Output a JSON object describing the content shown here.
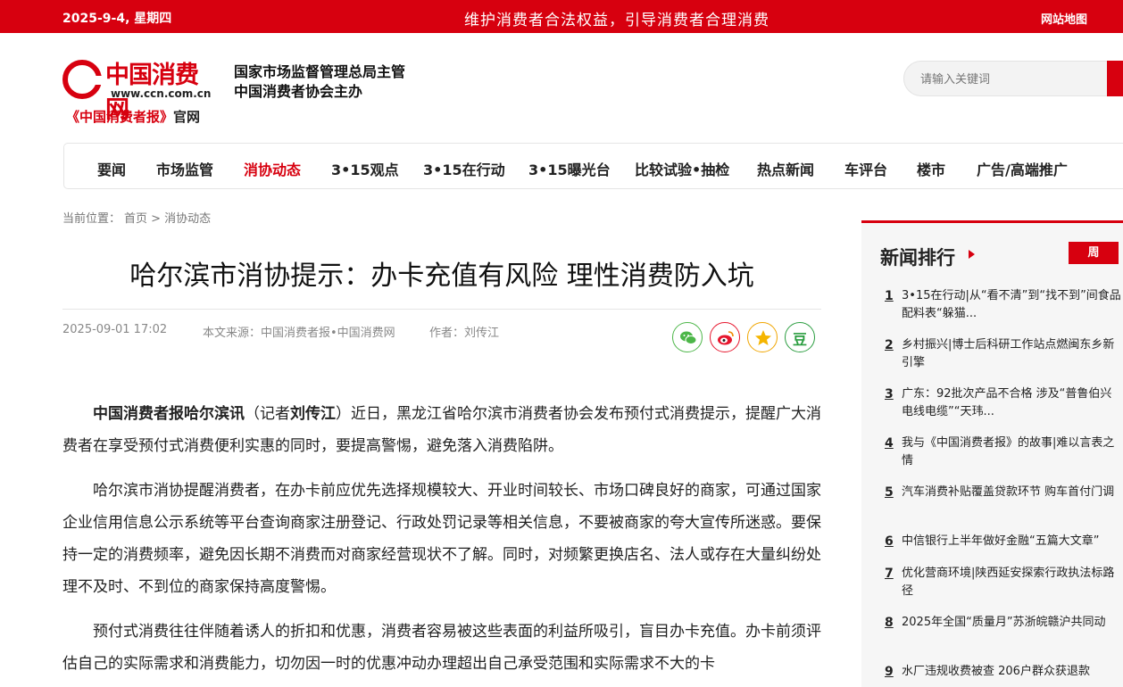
{
  "topbar": {
    "date": "2025-9-4, 星期四",
    "slogan": "维护消费者合法权益，引导消费者合理消费",
    "sitemap": "网站地图"
  },
  "logo": {
    "name": "中国消费网",
    "url": "www.ccn.com.cn",
    "official_prefix": "《中国消费者报》",
    "official_suffix": "官网"
  },
  "sponsor": {
    "line1": "国家市场监督管理总局主管",
    "line2": "中国消费者协会主办"
  },
  "search": {
    "placeholder": "请输入关键词"
  },
  "nav": [
    {
      "label": "要闻"
    },
    {
      "label": "市场监管"
    },
    {
      "label": "消协动态"
    },
    {
      "label": "3•15观点"
    },
    {
      "label": "3•15在行动"
    },
    {
      "label": "3•15曝光台"
    },
    {
      "label": "比较试验•抽检"
    },
    {
      "label": "热点新闻"
    },
    {
      "label": "车评台"
    },
    {
      "label": "楼市"
    },
    {
      "label": "广告/高端推广"
    }
  ],
  "breadcrumb": {
    "prefix": "当前位置：",
    "home": "首页",
    "sep": ">",
    "current": "消协动态"
  },
  "article": {
    "title": "哈尔滨市消协提示：办卡充值有风险 理性消费防入坑",
    "date": "2025-09-01 17:02",
    "source": "本文来源：中国消费者报•中国消费网",
    "author": "作者：刘传江",
    "p1_lead": "中国消费者报哈尔滨讯",
    "p1_mid1": "（记者",
    "p1_reporter": "刘传江",
    "p1_rest": "）近日，黑龙江省哈尔滨市消费者协会发布预付式消费提示，提醒广大消费者在享受预付式消费便利实惠的同时，要提高警惕，避免落入消费陷阱。",
    "p2": "哈尔滨市消协提醒消费者，在办卡前应优先选择规模较大、开业时间较长、市场口碑良好的商家，可通过国家企业信用信息公示系统等平台查询商家注册登记、行政处罚记录等相关信息，不要被商家的夸大宣传所迷惑。要保持一定的消费频率，避免因长期不消费而对商家经营现状不了解。同时，对频繁更换店名、法人或存在大量纠纷处理不及时、不到位的商家保持高度警惕。",
    "p3": "预付式消费往往伴随着诱人的折扣和优惠，消费者容易被这些表面的利益所吸引，盲目办卡充值。办卡前须评估自己的实际需求和消费能力，切勿因一时的优惠冲动办理超出自己承受范围和实际需求不大的卡"
  },
  "share": [
    {
      "icon": "wechat-icon",
      "color": "#4cb648"
    },
    {
      "icon": "weibo-icon",
      "color": "#e6162d"
    },
    {
      "icon": "star-icon",
      "color": "#f0a500"
    },
    {
      "icon": "douban-icon",
      "color": "#2a9d3f",
      "glyph": "豆"
    }
  ],
  "ranking": {
    "title": "新闻排行",
    "tab": "周",
    "items": [
      {
        "num": "1",
        "text": "3•15在行动|从“看不清”到“找不到”间食品配料表“躲猫..."
      },
      {
        "num": "2",
        "text": "乡村振兴|博士后科研工作站点燃闽东乡新引擎"
      },
      {
        "num": "3",
        "text": "广东：92批次产品不合格 涉及“普鲁伯兴电线电缆”“天玮..."
      },
      {
        "num": "4",
        "text": "我与《中国消费者报》的故事|难以言表之情"
      },
      {
        "num": "5",
        "text": "汽车消费补贴覆盖贷款环节 购车首付门调"
      },
      {
        "num": "6",
        "text": "中信银行上半年做好金融“五篇大文章”"
      },
      {
        "num": "7",
        "text": "优化营商环境|陕西延安探索行政执法标路径"
      },
      {
        "num": "8",
        "text": "2025年全国“质量月”苏浙皖赣沪共同动"
      },
      {
        "num": "9",
        "text": "水厂违规收费被查 206户群众获退款"
      }
    ]
  }
}
